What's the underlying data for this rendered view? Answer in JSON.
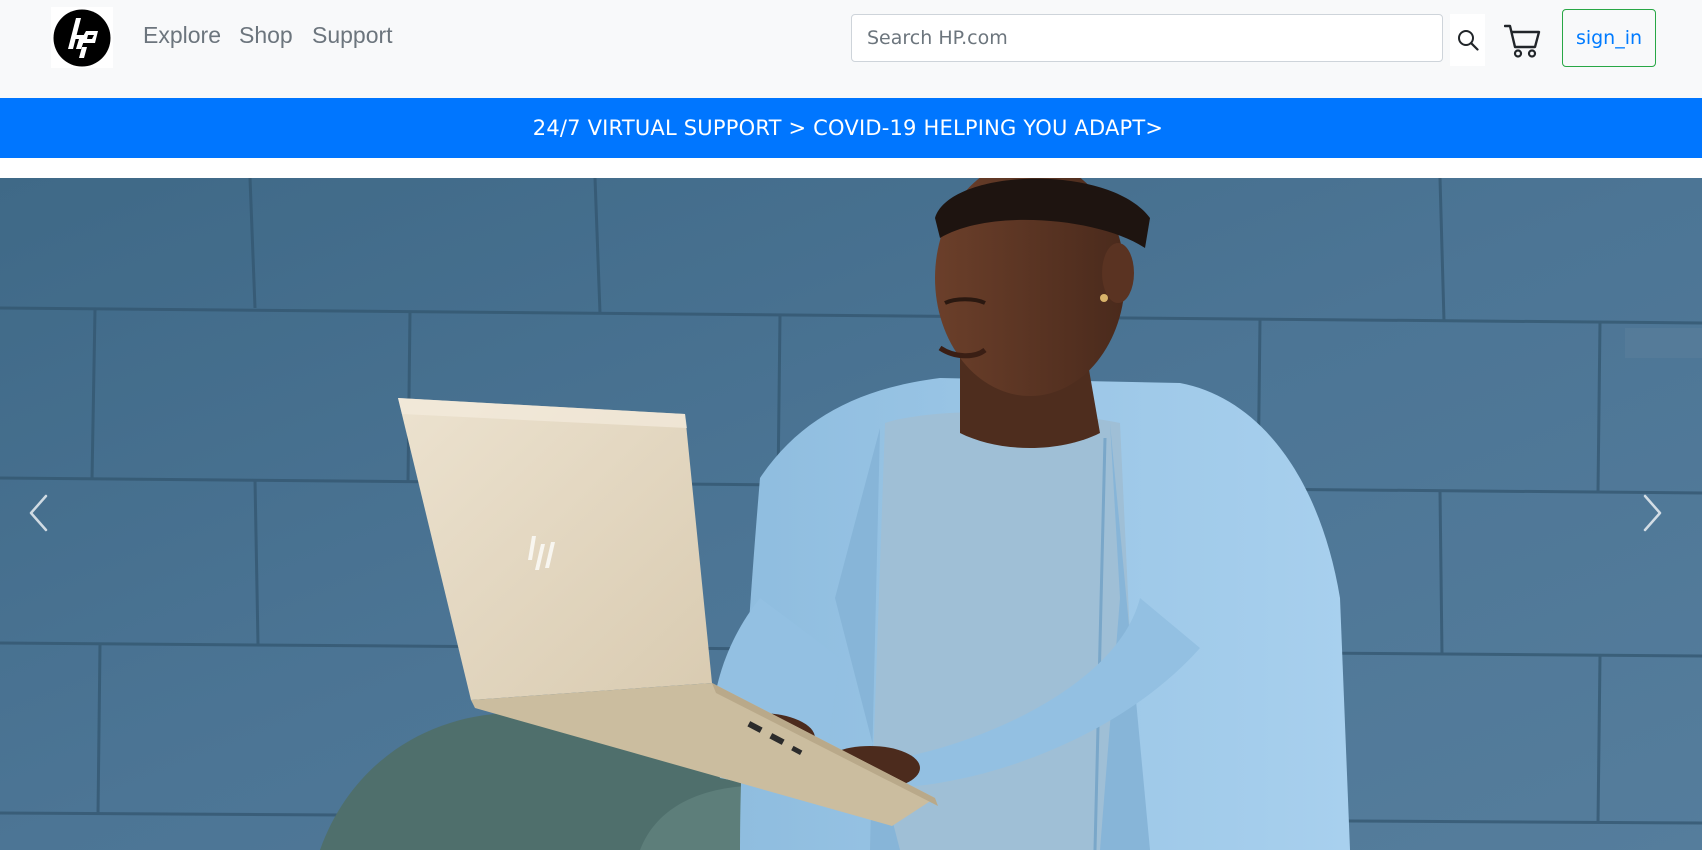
{
  "header": {
    "logo": {
      "text": "hp",
      "icon": "hp-logo"
    },
    "nav": [
      {
        "label": "Explore"
      },
      {
        "label": "Shop"
      },
      {
        "label": "Support"
      }
    ],
    "search": {
      "placeholder": "Search HP.com",
      "value": "",
      "icon": "search-icon"
    },
    "cart": {
      "icon": "cart-icon"
    },
    "sign_in_label": "sign_in"
  },
  "promo_bar": {
    "text": "24/7 VIRTUAL SUPPORT > COVID-19 HELPING YOU ADAPT>",
    "color": "#0076ff"
  },
  "hero": {
    "image": "person-using-laptop-against-blue-brick-wall",
    "laptop_logo": "hp",
    "prev_icon": "chevron-left-icon",
    "next_icon": "chevron-right-icon"
  },
  "colors": {
    "navbar_bg": "#f8f9fa",
    "nav_text": "#6c757d",
    "link_blue": "#007bff",
    "signin_border": "#28a745",
    "wall_blue": "#4b7392"
  }
}
